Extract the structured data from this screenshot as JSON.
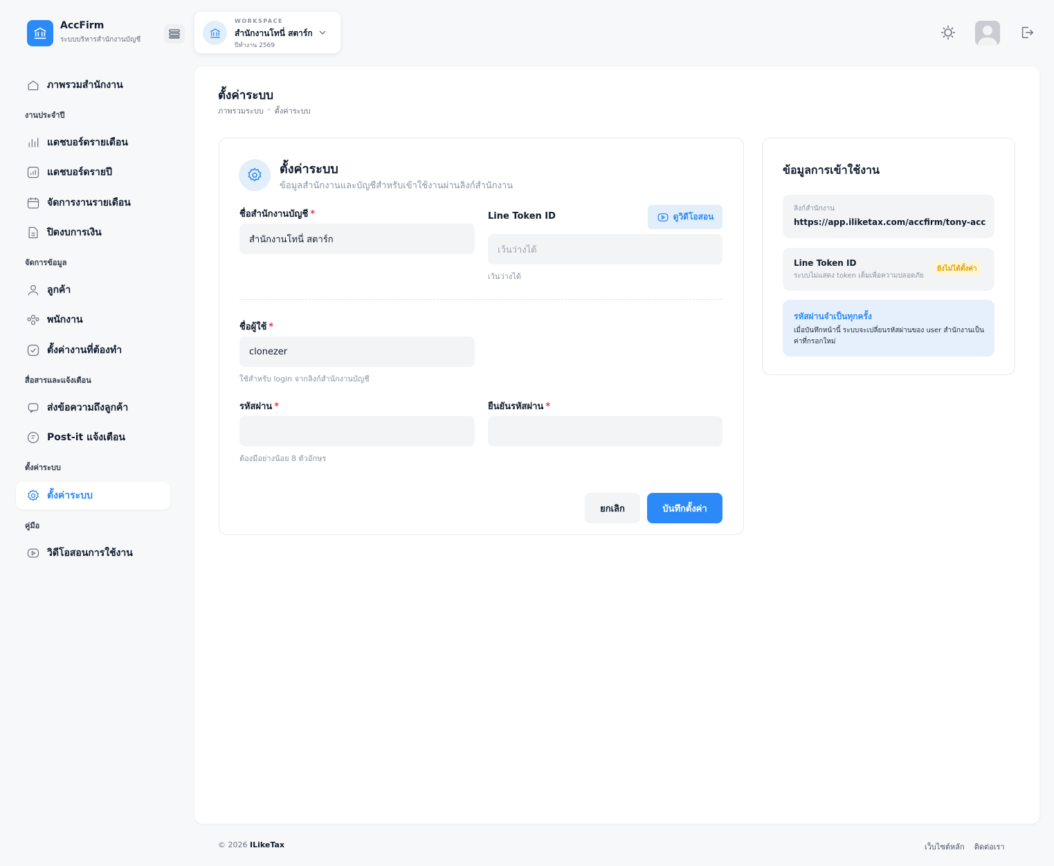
{
  "app": {
    "name": "AccFirm",
    "subtitle": "ระบบบริหารสำนักงานบัญชี"
  },
  "workspace": {
    "label": "WORKSPACE",
    "name": "สำนักงานโทนี่ สตาร์ก",
    "year": "ปีทำงาน 2569"
  },
  "sidebar": {
    "overview": "ภาพรวมสำนักงาน",
    "sections": [
      {
        "heading": "งานประจำปี",
        "items": [
          "แดชบอร์ดรายเดือน",
          "แดชบอร์ดรายปี",
          "จัดการงานรายเดือน",
          "ปิดงบการเงิน"
        ]
      },
      {
        "heading": "จัดการข้อมูล",
        "items": [
          "ลูกค้า",
          "พนักงาน",
          "ตั้งค่างานที่ต้องทำ"
        ]
      },
      {
        "heading": "สื่อสารและแจ้งเตือน",
        "items": [
          "ส่งข้อความถึงลูกค้า",
          "Post-it แจ้งเตือน"
        ]
      },
      {
        "heading": "ตั้งค่าระบบ",
        "items": [
          "ตั้งค่าระบบ"
        ]
      },
      {
        "heading": "คู่มือ",
        "items": [
          "วิดีโอสอนการใช้งาน"
        ]
      }
    ]
  },
  "page": {
    "title": "ตั้งค่าระบบ",
    "breadcrumb": [
      "ภาพรวมระบบ",
      "-",
      "ตั้งค่าระบบ"
    ]
  },
  "form": {
    "title": "ตั้งค่าระบบ",
    "description": "ข้อมูลสำนักงานและบัญชีสำหรับเข้าใช้งานผ่านลิงก์สำนักงาน",
    "office_name_label": "ชื่อสำนักงานบัญชี",
    "office_name_value": "สำนักงานโทนี่ สตาร์ก",
    "line_token_label": "Line Token ID",
    "video_button": "ดูวิดีโอสอน",
    "line_token_placeholder": "เว้นว่างได้",
    "line_token_hint": "เว้นว่างได้",
    "username_label": "ชื่อผู้ใช้",
    "username_value": "clonezer",
    "username_hint": "ใช้สำหรับ login จากลิงก์สำนักงานบัญชี",
    "password_label": "รหัสผ่าน",
    "password_hint": "ต้องมีอย่างน้อย 8 ตัวอักษร",
    "confirm_label": "ยืนยันรหัสผ่าน",
    "required_mark": "*",
    "cancel": "ยกเลิก",
    "save": "บันทึกตั้งค่า"
  },
  "access_info": {
    "title": "ข้อมูลการเข้าใช้งาน",
    "link_label": "ลิงก์สำนักงาน",
    "link_value": "https://app.iliketax.com/accfirm/tony-acc",
    "token_title": "Line Token ID",
    "token_desc": "ระบบไม่แสดง token เต็มเพื่อความปลอดภัย",
    "token_badge": "ยังไม่ได้ตั้งค่า",
    "password_note_title": "รหัสผ่านจำเป็นทุกครั้ง",
    "password_note_text": "เมื่อบันทึกหน้านี้ ระบบจะเปลี่ยนรหัสผ่านของ user สำนักงานเป็นค่าที่กรอกใหม่"
  },
  "footer": {
    "copyright": "© 2026",
    "brand": "ILikeTax",
    "links": [
      "เว็บไซต์หลัก",
      "ติดต่อเรา"
    ]
  },
  "colors": {
    "accent": "#2b8af7",
    "required": "#e5334b",
    "badge": "#e0a400"
  }
}
